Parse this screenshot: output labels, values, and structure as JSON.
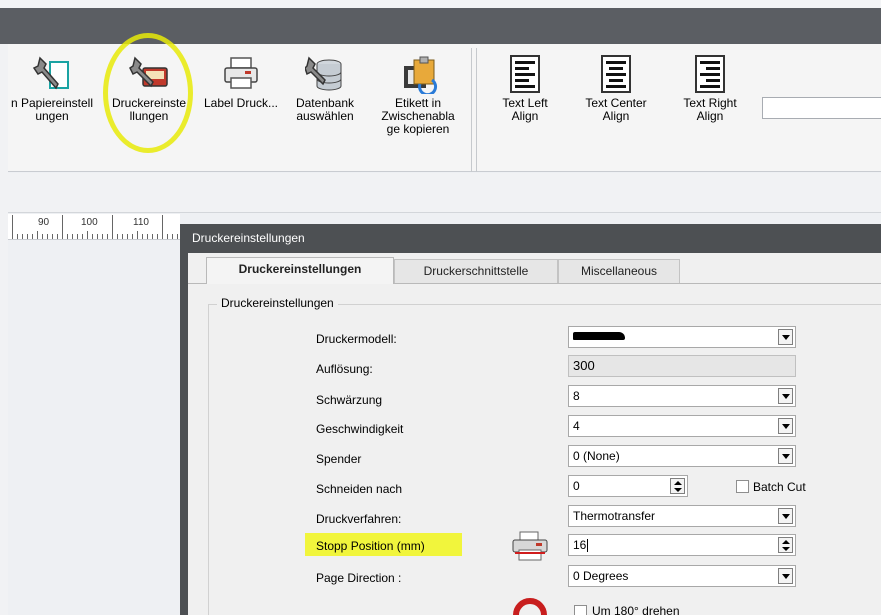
{
  "ribbon": {
    "buttons": [
      {
        "label": "n Papiereinstell ungen",
        "icon": "wrench-page-icon"
      },
      {
        "label": "Druckereinste llungen",
        "icon": "printer-settings-icon"
      },
      {
        "label": "Label Druck...",
        "icon": "printer-icon"
      },
      {
        "label": "Datenbank auswählen",
        "icon": "database-icon"
      },
      {
        "label": "Etikett in Zwischenabla ge kopieren",
        "icon": "clipboard-copy-icon"
      },
      {
        "label": "Text Left Align",
        "icon": "align-left-icon"
      },
      {
        "label": "Text Center Align",
        "icon": "align-center-icon"
      },
      {
        "label": "Text Right Align",
        "icon": "align-right-icon"
      }
    ],
    "search_value": ""
  },
  "ruler": {
    "ticks": [
      "90",
      "100",
      "110"
    ]
  },
  "dialog": {
    "title": "Druckereinstellungen",
    "tabs": [
      "Druckereinstellungen",
      "Druckerschnittstelle",
      "Miscellaneous"
    ],
    "group_title": "Druckereinstellungen",
    "fields": {
      "druckermodell": {
        "label": "Druckermodell:",
        "value": ""
      },
      "aufloesung": {
        "label": "Auflösung:",
        "value": "300"
      },
      "schwaerzung": {
        "label": "Schwärzung",
        "value": "8"
      },
      "geschwindigkeit": {
        "label": "Geschwindigkeit",
        "value": "4"
      },
      "spender": {
        "label": "Spender",
        "value": "0 (None)"
      },
      "schneiden": {
        "label": "Schneiden nach",
        "value": "0"
      },
      "batch_cut": {
        "label": "Batch Cut"
      },
      "druckverfahren": {
        "label": "Druckverfahren:",
        "value": "Thermotransfer"
      },
      "stopp": {
        "label": "Stopp Position (mm)",
        "value": "16"
      },
      "page_direction": {
        "label": "Page Direction :",
        "value": "0 Degrees"
      },
      "rotate": {
        "label": "Um 180° drehen"
      }
    }
  },
  "colors": {
    "highlight": "#e7ea08",
    "dialog_frame": "#4d5053",
    "titlebar": "#5b5e63"
  }
}
